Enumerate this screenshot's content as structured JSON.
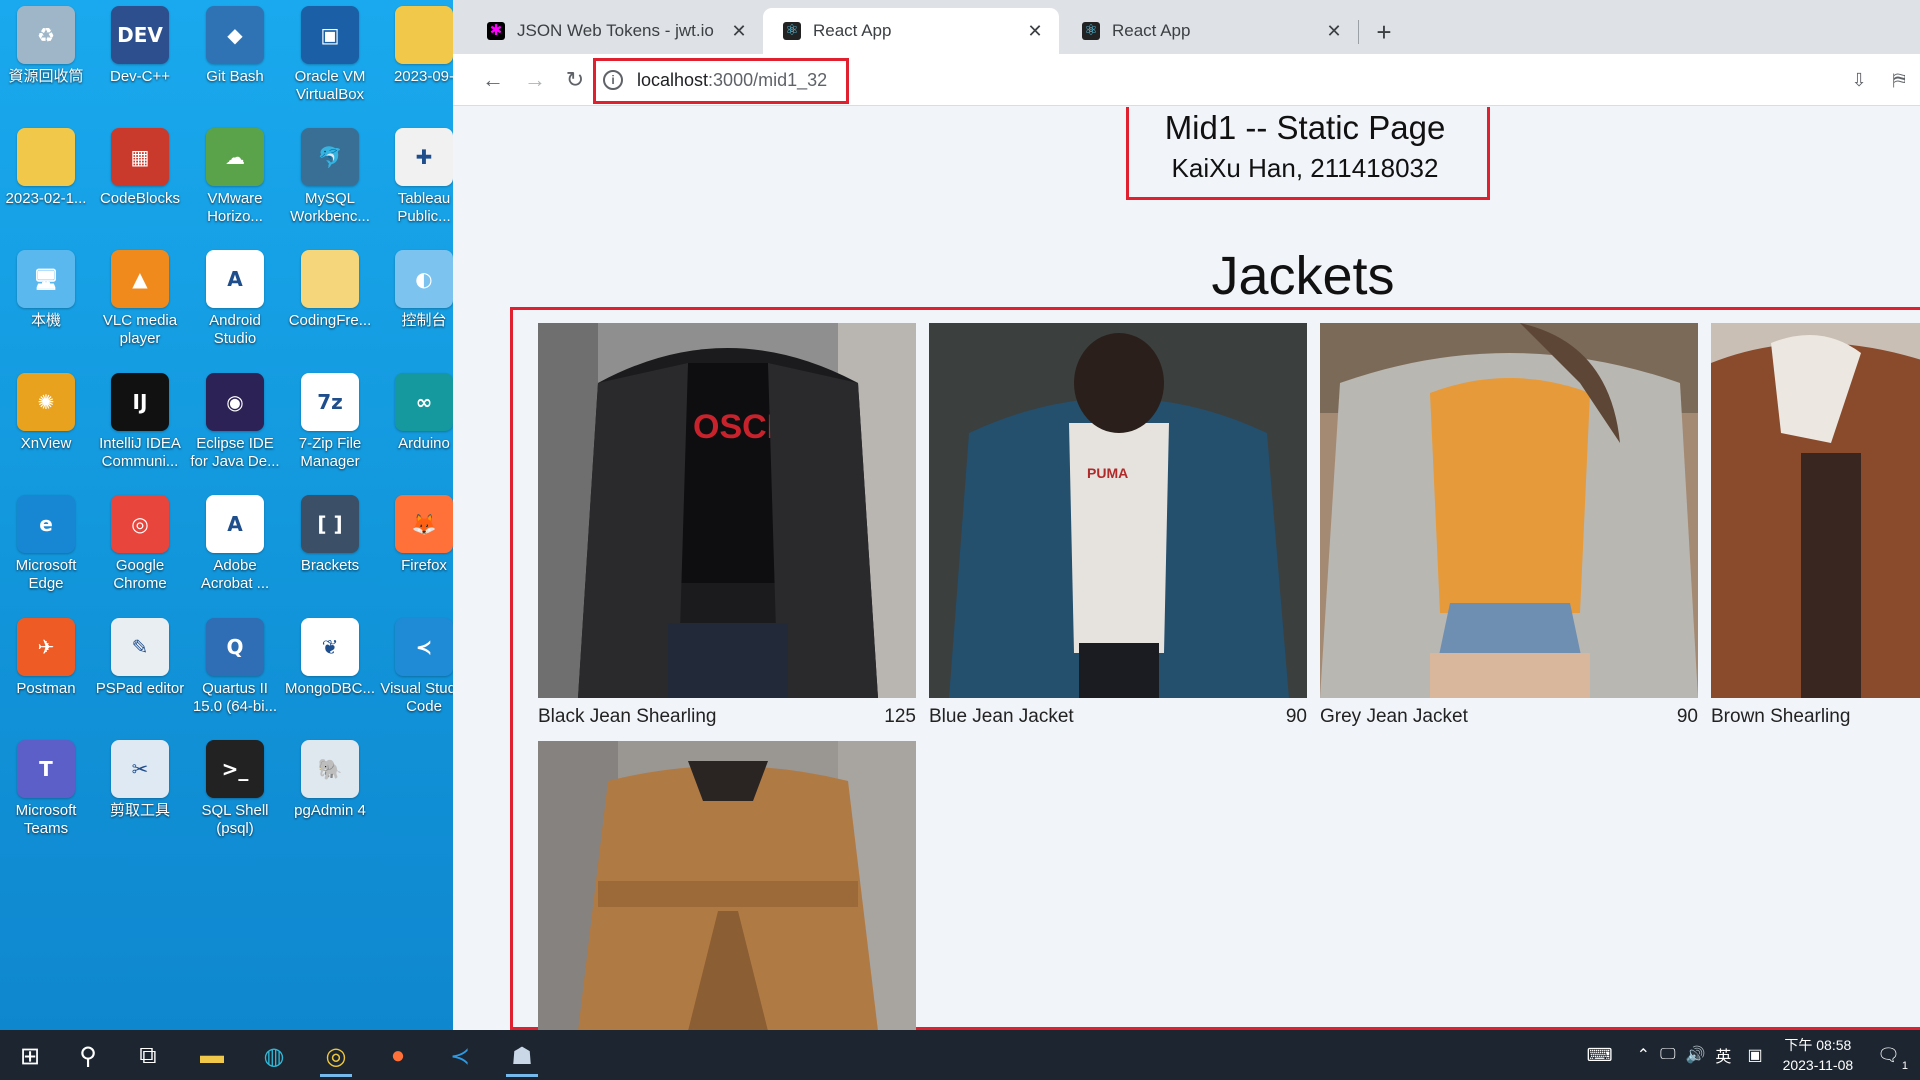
{
  "desktop": {
    "icons": [
      {
        "label": "資源回收筒",
        "icon": "recycle-bin-icon",
        "color": "#9fb6c8",
        "glyph": "♻"
      },
      {
        "label": "Dev-C++",
        "icon": "devcpp-icon",
        "color": "#2d4f8e",
        "glyph": "DEV"
      },
      {
        "label": "Git Bash",
        "icon": "git-bash-icon",
        "color": "#2f73b4",
        "glyph": "◆"
      },
      {
        "label": "Oracle VM VirtualBox",
        "icon": "virtualbox-icon",
        "color": "#1b5fa6",
        "glyph": "▣"
      },
      {
        "label": "2023-09-",
        "icon": "folder-icon",
        "color": "#f2c84b",
        "glyph": ""
      },
      {
        "label": "2023-02-1...",
        "icon": "folder-icon",
        "color": "#f2c84b",
        "glyph": ""
      },
      {
        "label": "CodeBlocks",
        "icon": "codeblocks-icon",
        "color": "#c93a2c",
        "glyph": "▦"
      },
      {
        "label": "VMware Horizo...",
        "icon": "vmware-horizon-icon",
        "color": "#5ba34a",
        "glyph": "☁"
      },
      {
        "label": "MySQL Workbenc...",
        "icon": "mysql-workbench-icon",
        "color": "#3a6f95",
        "glyph": "🐬"
      },
      {
        "label": "Tableau Public...",
        "icon": "tableau-icon",
        "color": "#f1f1f1",
        "glyph": "✚"
      },
      {
        "label": "本機",
        "icon": "this-pc-icon",
        "color": "#5bb8ee",
        "glyph": "🖥"
      },
      {
        "label": "VLC media player",
        "icon": "vlc-icon",
        "color": "#f08a1c",
        "glyph": "▲"
      },
      {
        "label": "Android Studio",
        "icon": "android-studio-icon",
        "color": "#ffffff",
        "glyph": "A"
      },
      {
        "label": "CodingFre...",
        "icon": "folder-icon",
        "color": "#f5d67a",
        "glyph": ""
      },
      {
        "label": "控制台",
        "icon": "control-panel-icon",
        "color": "#7cc3f0",
        "glyph": "◐"
      },
      {
        "label": "XnView",
        "icon": "xnview-icon",
        "color": "#e9a21d",
        "glyph": "✺"
      },
      {
        "label": "IntelliJ IDEA Communi...",
        "icon": "intellij-icon",
        "color": "#111111",
        "glyph": "IJ"
      },
      {
        "label": "Eclipse IDE for Java De...",
        "icon": "eclipse-icon",
        "color": "#2c2255",
        "glyph": "◉"
      },
      {
        "label": "7-Zip File Manager",
        "icon": "seven-zip-icon",
        "color": "#ffffff",
        "glyph": "7z"
      },
      {
        "label": "Arduino",
        "icon": "arduino-icon",
        "color": "#15989e",
        "glyph": "∞"
      },
      {
        "label": "Microsoft Edge",
        "icon": "edge-icon",
        "color": "#1787d4",
        "glyph": "e"
      },
      {
        "label": "Google Chrome",
        "icon": "chrome-icon",
        "color": "#e8453c",
        "glyph": "◎"
      },
      {
        "label": "Adobe Acrobat ...",
        "icon": "acrobat-icon",
        "color": "#ffffff",
        "glyph": "A"
      },
      {
        "label": "Brackets",
        "icon": "brackets-icon",
        "color": "#3b4f66",
        "glyph": "[ ]"
      },
      {
        "label": "Firefox",
        "icon": "firefox-icon",
        "color": "#ff7139",
        "glyph": "🦊"
      },
      {
        "label": "Postman",
        "icon": "postman-icon",
        "color": "#ef5b25",
        "glyph": "✈"
      },
      {
        "label": "PSPad editor",
        "icon": "pspad-icon",
        "color": "#e9eef2",
        "glyph": "✎"
      },
      {
        "label": "Quartus II 15.0 (64-bi...",
        "icon": "quartus-icon",
        "color": "#2f6db5",
        "glyph": "Q"
      },
      {
        "label": "MongoDBC...",
        "icon": "mongodb-compass-icon",
        "color": "#ffffff",
        "glyph": "❦"
      },
      {
        "label": "Visual Studio Code",
        "icon": "vscode-icon",
        "color": "#1f8ad6",
        "glyph": "≺"
      },
      {
        "label": "Microsoft Teams",
        "icon": "teams-icon",
        "color": "#5b5fc7",
        "glyph": "T"
      },
      {
        "label": "剪取工具",
        "icon": "snipping-tool-icon",
        "color": "#dfe9f3",
        "glyph": "✂"
      },
      {
        "label": "SQL Shell (psql)",
        "icon": "psql-icon",
        "color": "#222222",
        "glyph": ">_"
      },
      {
        "label": "pgAdmin 4",
        "icon": "pgadmin-icon",
        "color": "#dfe7ef",
        "glyph": "🐘"
      }
    ]
  },
  "browser": {
    "tabs": [
      {
        "title": "JSON Web Tokens - jwt.io",
        "favicon": "jwt-favicon-icon",
        "active": false
      },
      {
        "title": "React App",
        "favicon": "react-favicon-icon",
        "active": true
      },
      {
        "title": "React App",
        "favicon": "react-favicon-icon",
        "active": false
      }
    ],
    "address": {
      "host": "localhost",
      "path": ":3000/mid1_32"
    },
    "highlight_color": "#e0202f"
  },
  "page": {
    "title": "Mid1 -- Static Page",
    "subtitle": "KaiXu Han, 211418032",
    "heading": "Jackets",
    "products": [
      {
        "name": "Black Jean Shearling",
        "price": "125",
        "photo": "black-jacket-photo"
      },
      {
        "name": "Blue Jean Jacket",
        "price": "90",
        "photo": "blue-jacket-photo"
      },
      {
        "name": "Grey Jean Jacket",
        "price": "90",
        "photo": "grey-jacket-photo"
      },
      {
        "name": "Brown Shearling",
        "price": "",
        "photo": "brown-shearling-photo"
      },
      {
        "name": "",
        "price": "",
        "photo": "tan-coat-photo"
      }
    ]
  },
  "taskbar": {
    "apps": [
      "start-icon",
      "search-icon",
      "task-view-icon",
      "file-explorer-icon",
      "edge-icon",
      "chrome-icon",
      "firefox-icon",
      "vscode-icon",
      "pgadmin-icon"
    ],
    "ime": "英",
    "time": "下午 08:58",
    "date": "2023-11-08",
    "notifications": "1"
  }
}
